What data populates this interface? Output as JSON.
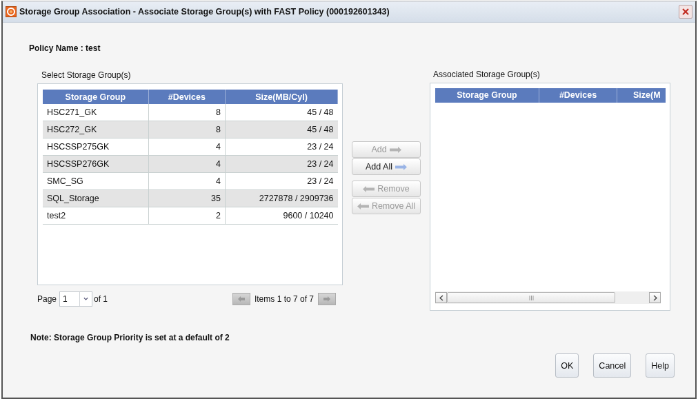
{
  "window": {
    "title": "Storage Group Association - Associate Storage Group(s) with FAST Policy (000192601343)"
  },
  "policy_name": "Policy Name : test",
  "left_panel": {
    "label": "Select Storage Group(s)",
    "table": {
      "columns": [
        "Storage Group",
        "#Devices",
        "Size(MB/Cyl)"
      ],
      "rows": [
        [
          "HSC271_GK",
          "8",
          "45 / 48"
        ],
        [
          "HSC272_GK",
          "8",
          "45 / 48"
        ],
        [
          "HSCSSP275GK",
          "4",
          "23 / 24"
        ],
        [
          "HSCSSP276GK",
          "4",
          "23 / 24"
        ],
        [
          "SMC_SG",
          "4",
          "23 / 24"
        ],
        [
          "SQL_Storage",
          "35",
          "2727878 / 2909736"
        ],
        [
          "test2",
          "2",
          "9600 / 10240"
        ]
      ]
    },
    "pager": {
      "page_label": "Page",
      "page_value": "1",
      "of_label": "of 1",
      "items_text": "Items 1 to 7 of 7"
    }
  },
  "transfer_buttons": [
    {
      "label": "Add",
      "kind": "add",
      "disabled": true
    },
    {
      "label": "Add All",
      "kind": "add",
      "disabled": false
    },
    {
      "label": "Remove",
      "kind": "remove",
      "disabled": true
    },
    {
      "label": "Remove All",
      "kind": "remove",
      "disabled": true
    }
  ],
  "right_panel": {
    "label": "Associated Storage Group(s)",
    "table": {
      "columns": [
        "Storage Group",
        "#Devices",
        "Size(M"
      ]
    }
  },
  "note": "Note: Storage Group Priority is set at a default of 2",
  "buttons": [
    "OK",
    "Cancel",
    "Help"
  ]
}
